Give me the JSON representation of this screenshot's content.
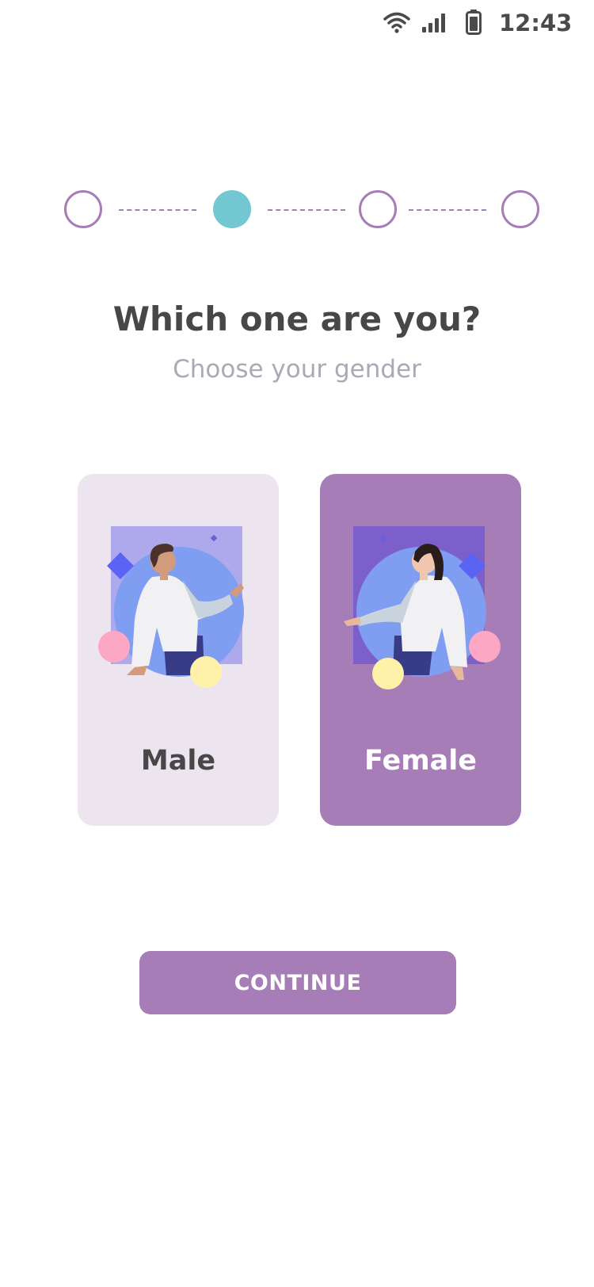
{
  "status_bar": {
    "time": "12:43",
    "icons": [
      "wifi-icon",
      "signal-icon",
      "battery-icon"
    ]
  },
  "stepper": {
    "total_steps": 4,
    "current_step": 2
  },
  "heading": {
    "title": "Which one are you?",
    "subtitle": "Choose your gender"
  },
  "options": [
    {
      "id": "male",
      "label": "Male",
      "selected": false,
      "illustration": "man-illustration"
    },
    {
      "id": "female",
      "label": "Female",
      "selected": true,
      "illustration": "woman-illustration"
    }
  ],
  "continue_button": {
    "label": "CONTINUE"
  },
  "colors": {
    "accent": "#a77db7",
    "active_step": "#72c7d3",
    "unselected_card": "#ece5ef",
    "title_text": "#474747",
    "subtitle_text": "#a8aab5"
  }
}
